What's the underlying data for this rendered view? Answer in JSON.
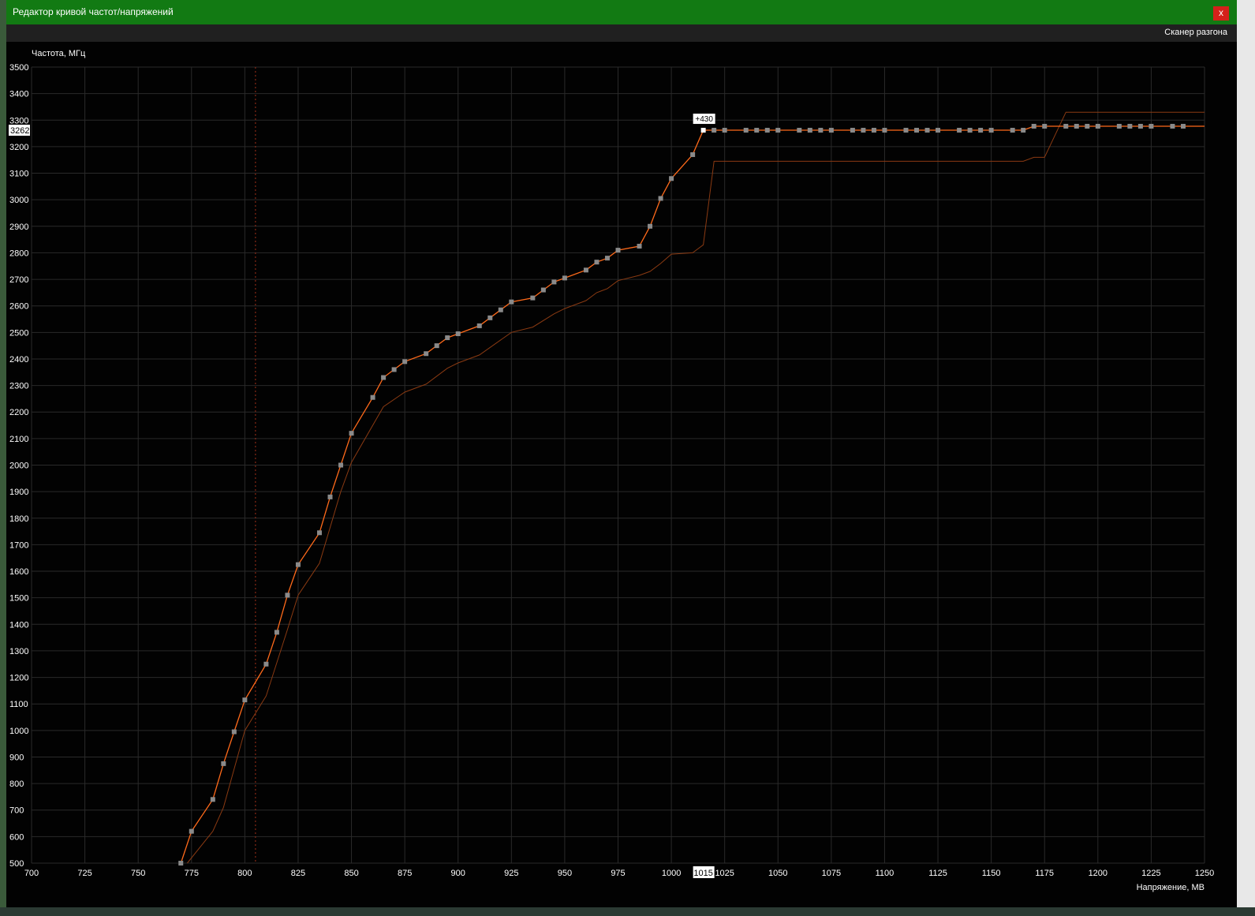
{
  "window": {
    "title": "Редактор кривой частот/напряжений",
    "close_label": "x",
    "menu_item": "Сканер разгона"
  },
  "colors": {
    "title_bar": "#127a13",
    "background": "#020202",
    "grid": "#2a2a2a",
    "curve": "#ff6a1a",
    "baseline_curve": "#8a3a12",
    "point": "#8a8a8a",
    "selected_point": "#ffffff",
    "marker_line": "#a0301a"
  },
  "chart_data": {
    "type": "line",
    "ylabel": "Частота, МГц",
    "xlabel": "Напряжение, МВ",
    "xlim": [
      700,
      1250
    ],
    "ylim": [
      500,
      3500
    ],
    "x_ticks": [
      700,
      725,
      750,
      775,
      800,
      825,
      850,
      875,
      900,
      925,
      950,
      975,
      1000,
      1025,
      1050,
      1075,
      1100,
      1125,
      1150,
      1175,
      1200,
      1225,
      1250
    ],
    "y_ticks": [
      500,
      600,
      700,
      800,
      900,
      1000,
      1100,
      1200,
      1300,
      1400,
      1500,
      1600,
      1700,
      1800,
      1900,
      2000,
      2100,
      2200,
      2300,
      2400,
      2500,
      2600,
      2700,
      2800,
      2900,
      3000,
      3100,
      3200,
      3300,
      3400,
      3500
    ],
    "grid": true,
    "vertical_marker_x": 805,
    "selected_point": {
      "x": 1015,
      "y": 3262,
      "x_label": "1015",
      "y_label": "3262",
      "offset_label": "+430"
    },
    "series": [
      {
        "points": [
          [
            770,
            500
          ],
          [
            775,
            620
          ],
          [
            785,
            740
          ],
          [
            790,
            875
          ],
          [
            795,
            995
          ],
          [
            800,
            1115
          ],
          [
            810,
            1250
          ],
          [
            815,
            1370
          ],
          [
            820,
            1510
          ],
          [
            825,
            1625
          ],
          [
            835,
            1745
          ],
          [
            840,
            1880
          ],
          [
            845,
            2000
          ],
          [
            850,
            2120
          ],
          [
            860,
            2255
          ],
          [
            865,
            2330
          ],
          [
            870,
            2360
          ],
          [
            875,
            2390
          ],
          [
            885,
            2420
          ],
          [
            890,
            2450
          ],
          [
            895,
            2480
          ],
          [
            900,
            2495
          ],
          [
            910,
            2525
          ],
          [
            915,
            2555
          ],
          [
            920,
            2585
          ],
          [
            925,
            2615
          ],
          [
            935,
            2630
          ],
          [
            940,
            2660
          ],
          [
            945,
            2690
          ],
          [
            950,
            2705
          ],
          [
            960,
            2735
          ],
          [
            965,
            2765
          ],
          [
            970,
            2780
          ],
          [
            975,
            2810
          ],
          [
            985,
            2825
          ],
          [
            990,
            2900
          ],
          [
            995,
            3005
          ],
          [
            1000,
            3080
          ],
          [
            1010,
            3170
          ],
          [
            1015,
            3262
          ],
          [
            1020,
            3262
          ],
          [
            1025,
            3262
          ],
          [
            1035,
            3262
          ],
          [
            1040,
            3262
          ],
          [
            1045,
            3262
          ],
          [
            1050,
            3262
          ],
          [
            1060,
            3262
          ],
          [
            1065,
            3262
          ],
          [
            1070,
            3262
          ],
          [
            1075,
            3262
          ],
          [
            1085,
            3262
          ],
          [
            1090,
            3262
          ],
          [
            1095,
            3262
          ],
          [
            1100,
            3262
          ],
          [
            1110,
            3262
          ],
          [
            1115,
            3262
          ],
          [
            1120,
            3262
          ],
          [
            1125,
            3262
          ],
          [
            1135,
            3262
          ],
          [
            1140,
            3262
          ],
          [
            1145,
            3262
          ],
          [
            1150,
            3262
          ],
          [
            1160,
            3262
          ],
          [
            1165,
            3262
          ],
          [
            1170,
            3277
          ],
          [
            1175,
            3277
          ],
          [
            1185,
            3277
          ],
          [
            1190,
            3277
          ],
          [
            1195,
            3277
          ],
          [
            1200,
            3277
          ],
          [
            1210,
            3277
          ],
          [
            1215,
            3277
          ],
          [
            1220,
            3277
          ],
          [
            1225,
            3277
          ],
          [
            1235,
            3277
          ],
          [
            1240,
            3277
          ],
          [
            1250,
            3277
          ]
        ]
      },
      {
        "points": [
          [
            773,
            500
          ],
          [
            785,
            620
          ],
          [
            790,
            710
          ],
          [
            800,
            1000
          ],
          [
            810,
            1130
          ],
          [
            820,
            1380
          ],
          [
            825,
            1510
          ],
          [
            835,
            1630
          ],
          [
            845,
            1900
          ],
          [
            850,
            2010
          ],
          [
            865,
            2220
          ],
          [
            875,
            2275
          ],
          [
            885,
            2305
          ],
          [
            895,
            2365
          ],
          [
            900,
            2385
          ],
          [
            910,
            2415
          ],
          [
            925,
            2500
          ],
          [
            935,
            2520
          ],
          [
            945,
            2570
          ],
          [
            950,
            2590
          ],
          [
            960,
            2620
          ],
          [
            965,
            2650
          ],
          [
            970,
            2665
          ],
          [
            975,
            2695
          ],
          [
            985,
            2715
          ],
          [
            990,
            2730
          ],
          [
            995,
            2760
          ],
          [
            1000,
            2795
          ],
          [
            1010,
            2800
          ],
          [
            1015,
            2830
          ],
          [
            1020,
            3145
          ],
          [
            1165,
            3145
          ],
          [
            1170,
            3160
          ],
          [
            1175,
            3160
          ],
          [
            1185,
            3330
          ],
          [
            1250,
            3330
          ]
        ]
      }
    ]
  }
}
